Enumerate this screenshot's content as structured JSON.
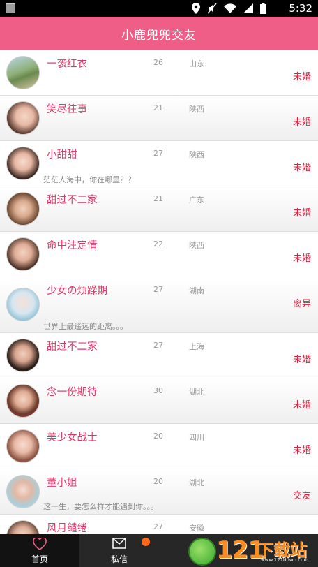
{
  "status_bar": {
    "time": "5:32"
  },
  "header": {
    "title": "小鹿兜兜交友"
  },
  "users": [
    {
      "name": "一袭红衣",
      "age": "26",
      "region": "山东",
      "status": "未婚",
      "signature": ""
    },
    {
      "name": "笑尽往事",
      "age": "21",
      "region": "陕西",
      "status": "未婚",
      "signature": ""
    },
    {
      "name": "小甜甜",
      "age": "27",
      "region": "陕西",
      "status": "未婚",
      "signature": "茫茫人海中，你在哪里？？"
    },
    {
      "name": "甜过不二家",
      "age": "21",
      "region": "广东",
      "status": "未婚",
      "signature": ""
    },
    {
      "name": "命中注定情",
      "age": "22",
      "region": "陕西",
      "status": "未婚",
      "signature": ""
    },
    {
      "name": "少女の烦躁期",
      "age": "27",
      "region": "湖南",
      "status": "离异",
      "signature": "世界上最遥远的距离。。。"
    },
    {
      "name": "甜过不二家",
      "age": "27",
      "region": "上海",
      "status": "未婚",
      "signature": ""
    },
    {
      "name": "念一份期待",
      "age": "30",
      "region": "湖北",
      "status": "未婚",
      "signature": ""
    },
    {
      "name": "美少女战士",
      "age": "20",
      "region": "四川",
      "status": "未婚",
      "signature": ""
    },
    {
      "name": "董小姐",
      "age": "20",
      "region": "湖北",
      "status": "交友",
      "signature": "这一生，要怎么样才能遇到你。。。"
    },
    {
      "name": "风月缱绻",
      "age": "27",
      "region": "安徽",
      "status": "",
      "signature": ""
    }
  ],
  "tabs": [
    {
      "label": "首页",
      "icon": "heart-icon"
    },
    {
      "label": "私信",
      "icon": "mail-icon"
    },
    {
      "label": "",
      "icon": ""
    },
    {
      "label": "",
      "icon": ""
    }
  ],
  "watermark": {
    "number": "121",
    "text": "下载站",
    "url": "www.121down.com"
  },
  "colors": {
    "accent": "#ee5e86",
    "name": "#e3376a",
    "status": "#e0203e",
    "tabbar": "#272727",
    "badge": "#ff6a1a"
  }
}
